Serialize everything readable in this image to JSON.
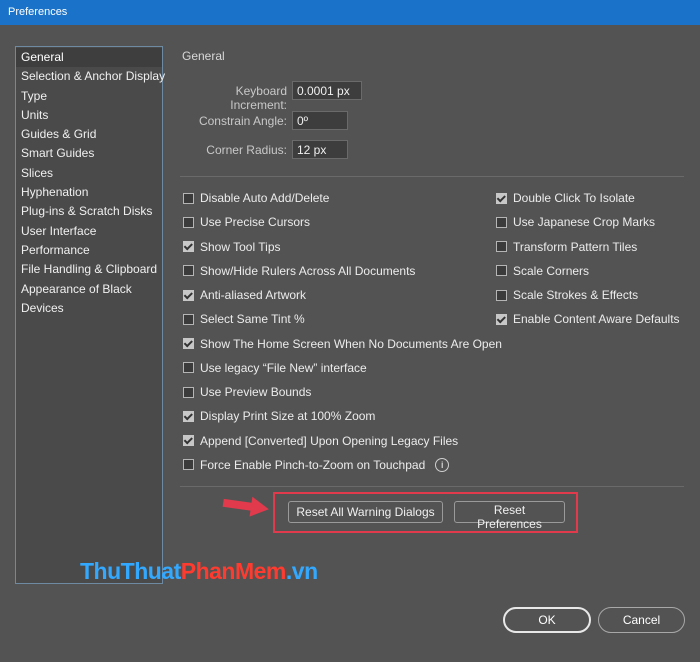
{
  "window": {
    "title": "Preferences"
  },
  "sidebar": {
    "items": [
      {
        "label": "General",
        "selected": true
      },
      {
        "label": "Selection & Anchor Display"
      },
      {
        "label": "Type"
      },
      {
        "label": "Units"
      },
      {
        "label": "Guides & Grid"
      },
      {
        "label": "Smart Guides"
      },
      {
        "label": "Slices"
      },
      {
        "label": "Hyphenation"
      },
      {
        "label": "Plug-ins & Scratch Disks"
      },
      {
        "label": "User Interface"
      },
      {
        "label": "Performance"
      },
      {
        "label": "File Handling & Clipboard"
      },
      {
        "label": "Appearance of Black"
      },
      {
        "label": "Devices"
      }
    ]
  },
  "general": {
    "section_title": "General",
    "keyboard_increment": {
      "label": "Keyboard Increment:",
      "value": "0.0001 px"
    },
    "constrain_angle": {
      "label": "Constrain Angle:",
      "value": "0º"
    },
    "corner_radius": {
      "label": "Corner Radius:",
      "value": "12 px"
    },
    "left_options": [
      {
        "label": "Disable Auto Add/Delete",
        "checked": false
      },
      {
        "label": "Use Precise Cursors",
        "checked": false
      },
      {
        "label": "Show Tool Tips",
        "checked": true
      },
      {
        "label": "Show/Hide Rulers Across All Documents",
        "checked": false
      },
      {
        "label": "Anti-aliased Artwork",
        "checked": true
      },
      {
        "label": "Select Same Tint %",
        "checked": false
      },
      {
        "label": "Show The Home Screen When No Documents Are Open",
        "checked": true
      },
      {
        "label": "Use legacy “File New” interface",
        "checked": false
      },
      {
        "label": "Use Preview Bounds",
        "checked": false
      },
      {
        "label": "Display Print Size at 100% Zoom",
        "checked": true
      },
      {
        "label": "Append [Converted] Upon Opening Legacy Files",
        "checked": true
      },
      {
        "label": "Force Enable Pinch-to-Zoom on Touchpad",
        "checked": false,
        "info_icon": "info-icon"
      }
    ],
    "right_options": [
      {
        "label": "Double Click To Isolate",
        "checked": true
      },
      {
        "label": "Use Japanese Crop Marks",
        "checked": false
      },
      {
        "label": "Transform Pattern Tiles",
        "checked": false
      },
      {
        "label": "Scale Corners",
        "checked": false
      },
      {
        "label": "Scale Strokes & Effects",
        "checked": false
      },
      {
        "label": "Enable Content Aware Defaults",
        "checked": true
      }
    ],
    "reset_warning_label": "Reset All Warning Dialogs",
    "reset_prefs_label": "Reset Preferences"
  },
  "footer": {
    "ok_label": "OK",
    "cancel_label": "Cancel"
  },
  "watermark": {
    "part1": "ThuThuat",
    "part2": "PhanMem",
    "part3": ".vn"
  },
  "annotation": {
    "highlight_color": "#e03a4c",
    "arrow_icon": "right-arrow-icon"
  }
}
